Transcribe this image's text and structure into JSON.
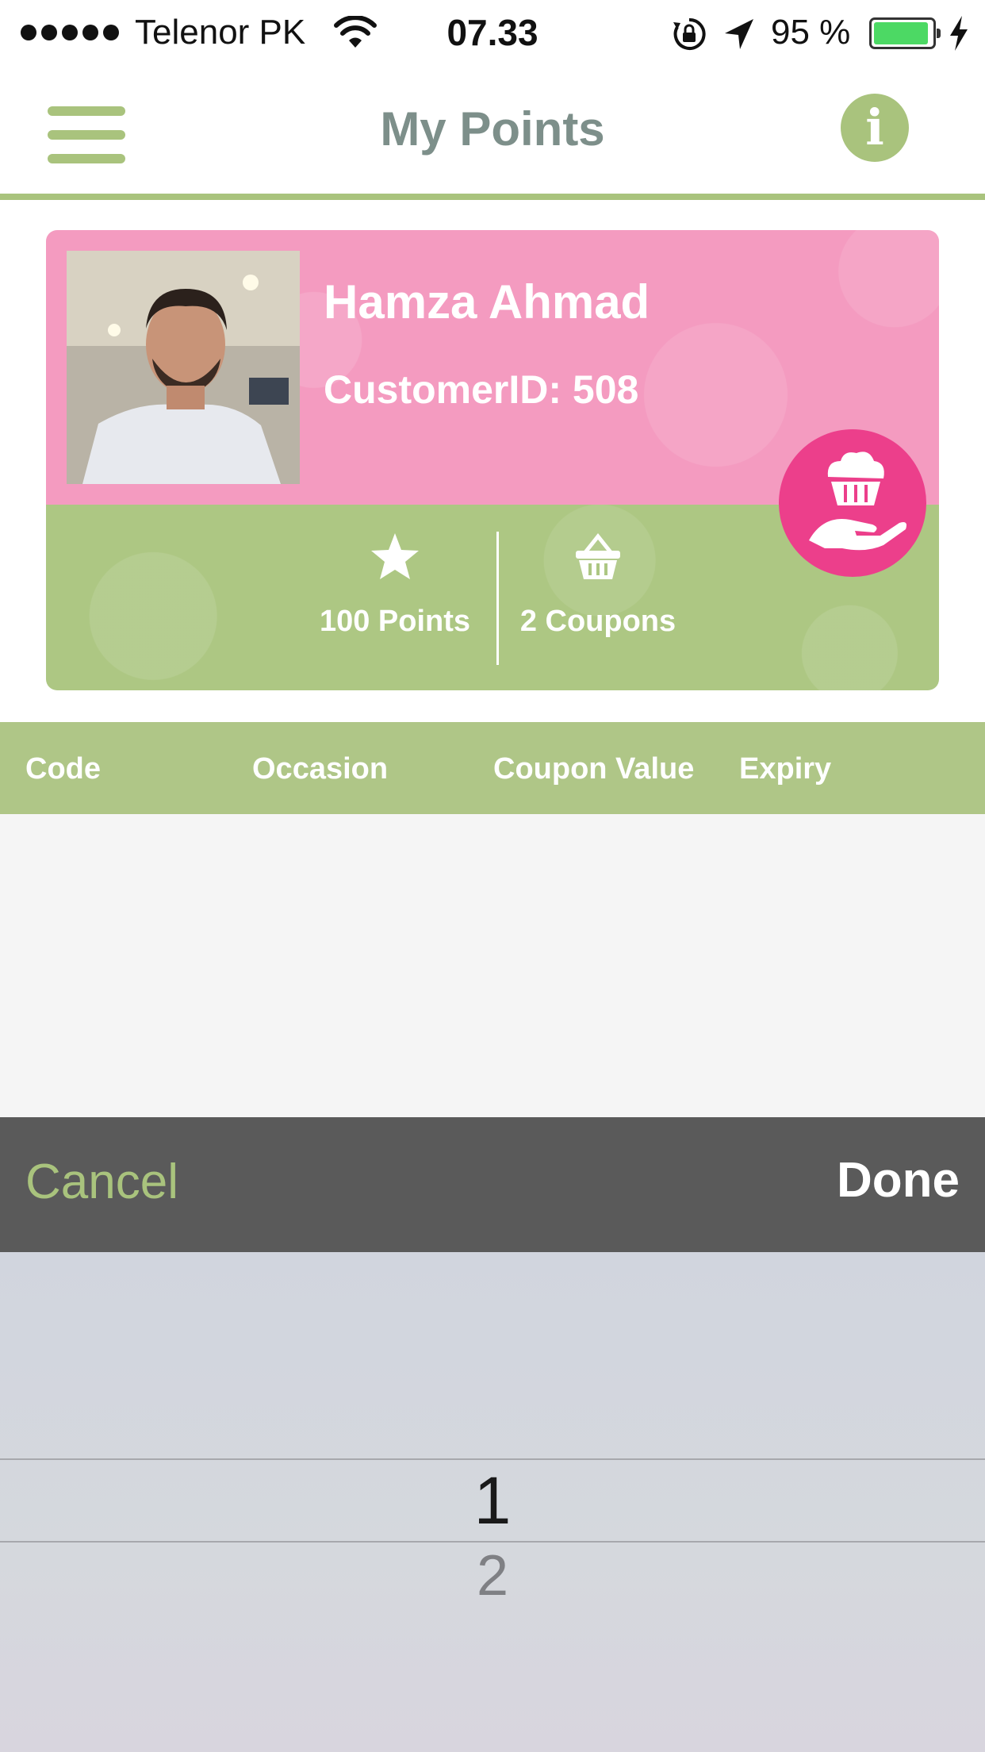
{
  "status_bar": {
    "carrier": "Telenor PK",
    "time": "07.33",
    "battery_percent": "95 %",
    "battery_level": 0.95
  },
  "nav": {
    "title": "My Points"
  },
  "profile": {
    "name": "Hamza Ahmad",
    "customer_id": "CustomerID: 508",
    "points_label": "100 Points",
    "coupons_label": "2 Coupons"
  },
  "table": {
    "columns": [
      "Code",
      "Occasion",
      "Coupon Value",
      "Expiry"
    ]
  },
  "picker": {
    "cancel_label": "Cancel",
    "done_label": "Done",
    "selected_value": "1",
    "next_value": "2"
  },
  "colors": {
    "accent_green": "#a9c37d",
    "card_pink": "#f49bc0",
    "badge_pink": "#ec3f8b",
    "toolbar_gray": "#5a5a5a",
    "title_gray": "#7d8f8a"
  },
  "icons": [
    "menu-icon",
    "info-icon",
    "star-icon",
    "basket-icon",
    "cupcake-hand-icon",
    "wifi-icon",
    "rotation-lock-icon",
    "location-arrow-icon",
    "battery-icon",
    "charging-bolt-icon"
  ]
}
